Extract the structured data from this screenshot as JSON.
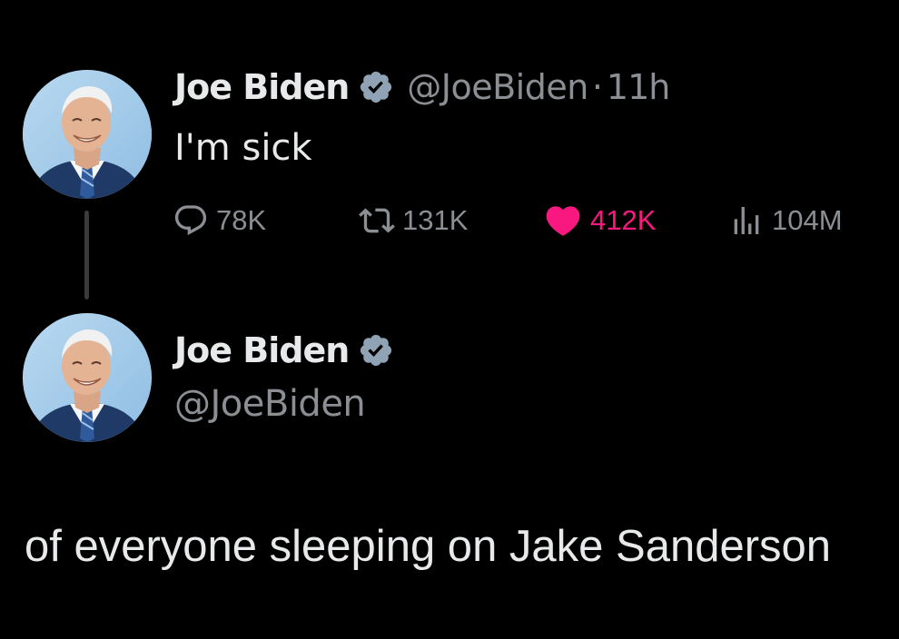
{
  "colors": {
    "background": "#000000",
    "primary_text": "#e7e9ea",
    "secondary_text": "#8b8f94",
    "like_active": "#f91880",
    "verified_badge": "#8fa3b5",
    "thread_line": "#3a3a3a"
  },
  "tweet": {
    "display_name": "Joe Biden",
    "verified": true,
    "handle": "@JoeBiden",
    "separator": "·",
    "time": "11h",
    "text": "I'm sick",
    "avatar_icon": "profile-photo",
    "actions": {
      "reply": {
        "icon": "reply-icon",
        "count": "78K"
      },
      "retweet": {
        "icon": "retweet-icon",
        "count": "131K"
      },
      "like": {
        "icon": "heart-icon",
        "count": "412K",
        "active": true
      },
      "views": {
        "icon": "views-icon",
        "count": "104M"
      }
    }
  },
  "reply": {
    "display_name": "Joe Biden",
    "verified": true,
    "handle": "@JoeBiden",
    "avatar_icon": "profile-photo",
    "text": "of everyone sleeping on Jake Sanderson"
  }
}
